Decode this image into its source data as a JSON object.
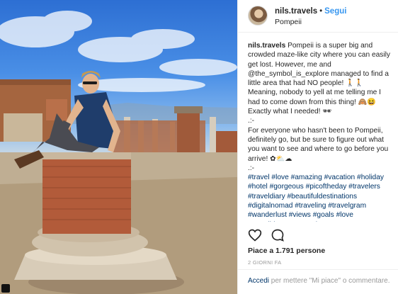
{
  "post": {
    "username": "nils.travels",
    "separator": "•",
    "follow_label": "Segui",
    "location": "Pompeii"
  },
  "caption": {
    "username": "nils.travels",
    "line1": "Pompeii is a super big and crowded maze-like city where you can easily get lost. However, me and @the_symbol_is_explore managed to find a little area that had NO people! 🚶🚶 Meaning, nobody to yell at me telling me I had to come down from this thing! 🙈😆 Exactly what I needed! 🕶",
    "sep1": ".:-",
    "line2": "For everyone who hasn't been to Pompeii, definitely go, but be sure to figure out what you want to see and where to go before you arrive! ✿⛅☁",
    "sep2": ".:-",
    "hashtags": "#travel #love #amazing #vacation #holiday #hotel #gorgeous #picoftheday #travelers #traveldiary #beautifuldestinations #digitalnomad #traveling #travelgram #wanderlust #views #goals #love #travelblogger #travels"
  },
  "actions": {
    "like_icon": "heart-icon",
    "comment_icon": "comment-icon"
  },
  "likes_text": "Piace a 1.791 persone",
  "timestamp": "2 GIORNI FA",
  "login_prompt": {
    "link": "Accedi",
    "rest": " per mettere \"Mi piace\" o commentare."
  },
  "colors": {
    "link": "#003569",
    "follow": "#3897f0",
    "meta": "#999999",
    "border": "#efefef"
  }
}
